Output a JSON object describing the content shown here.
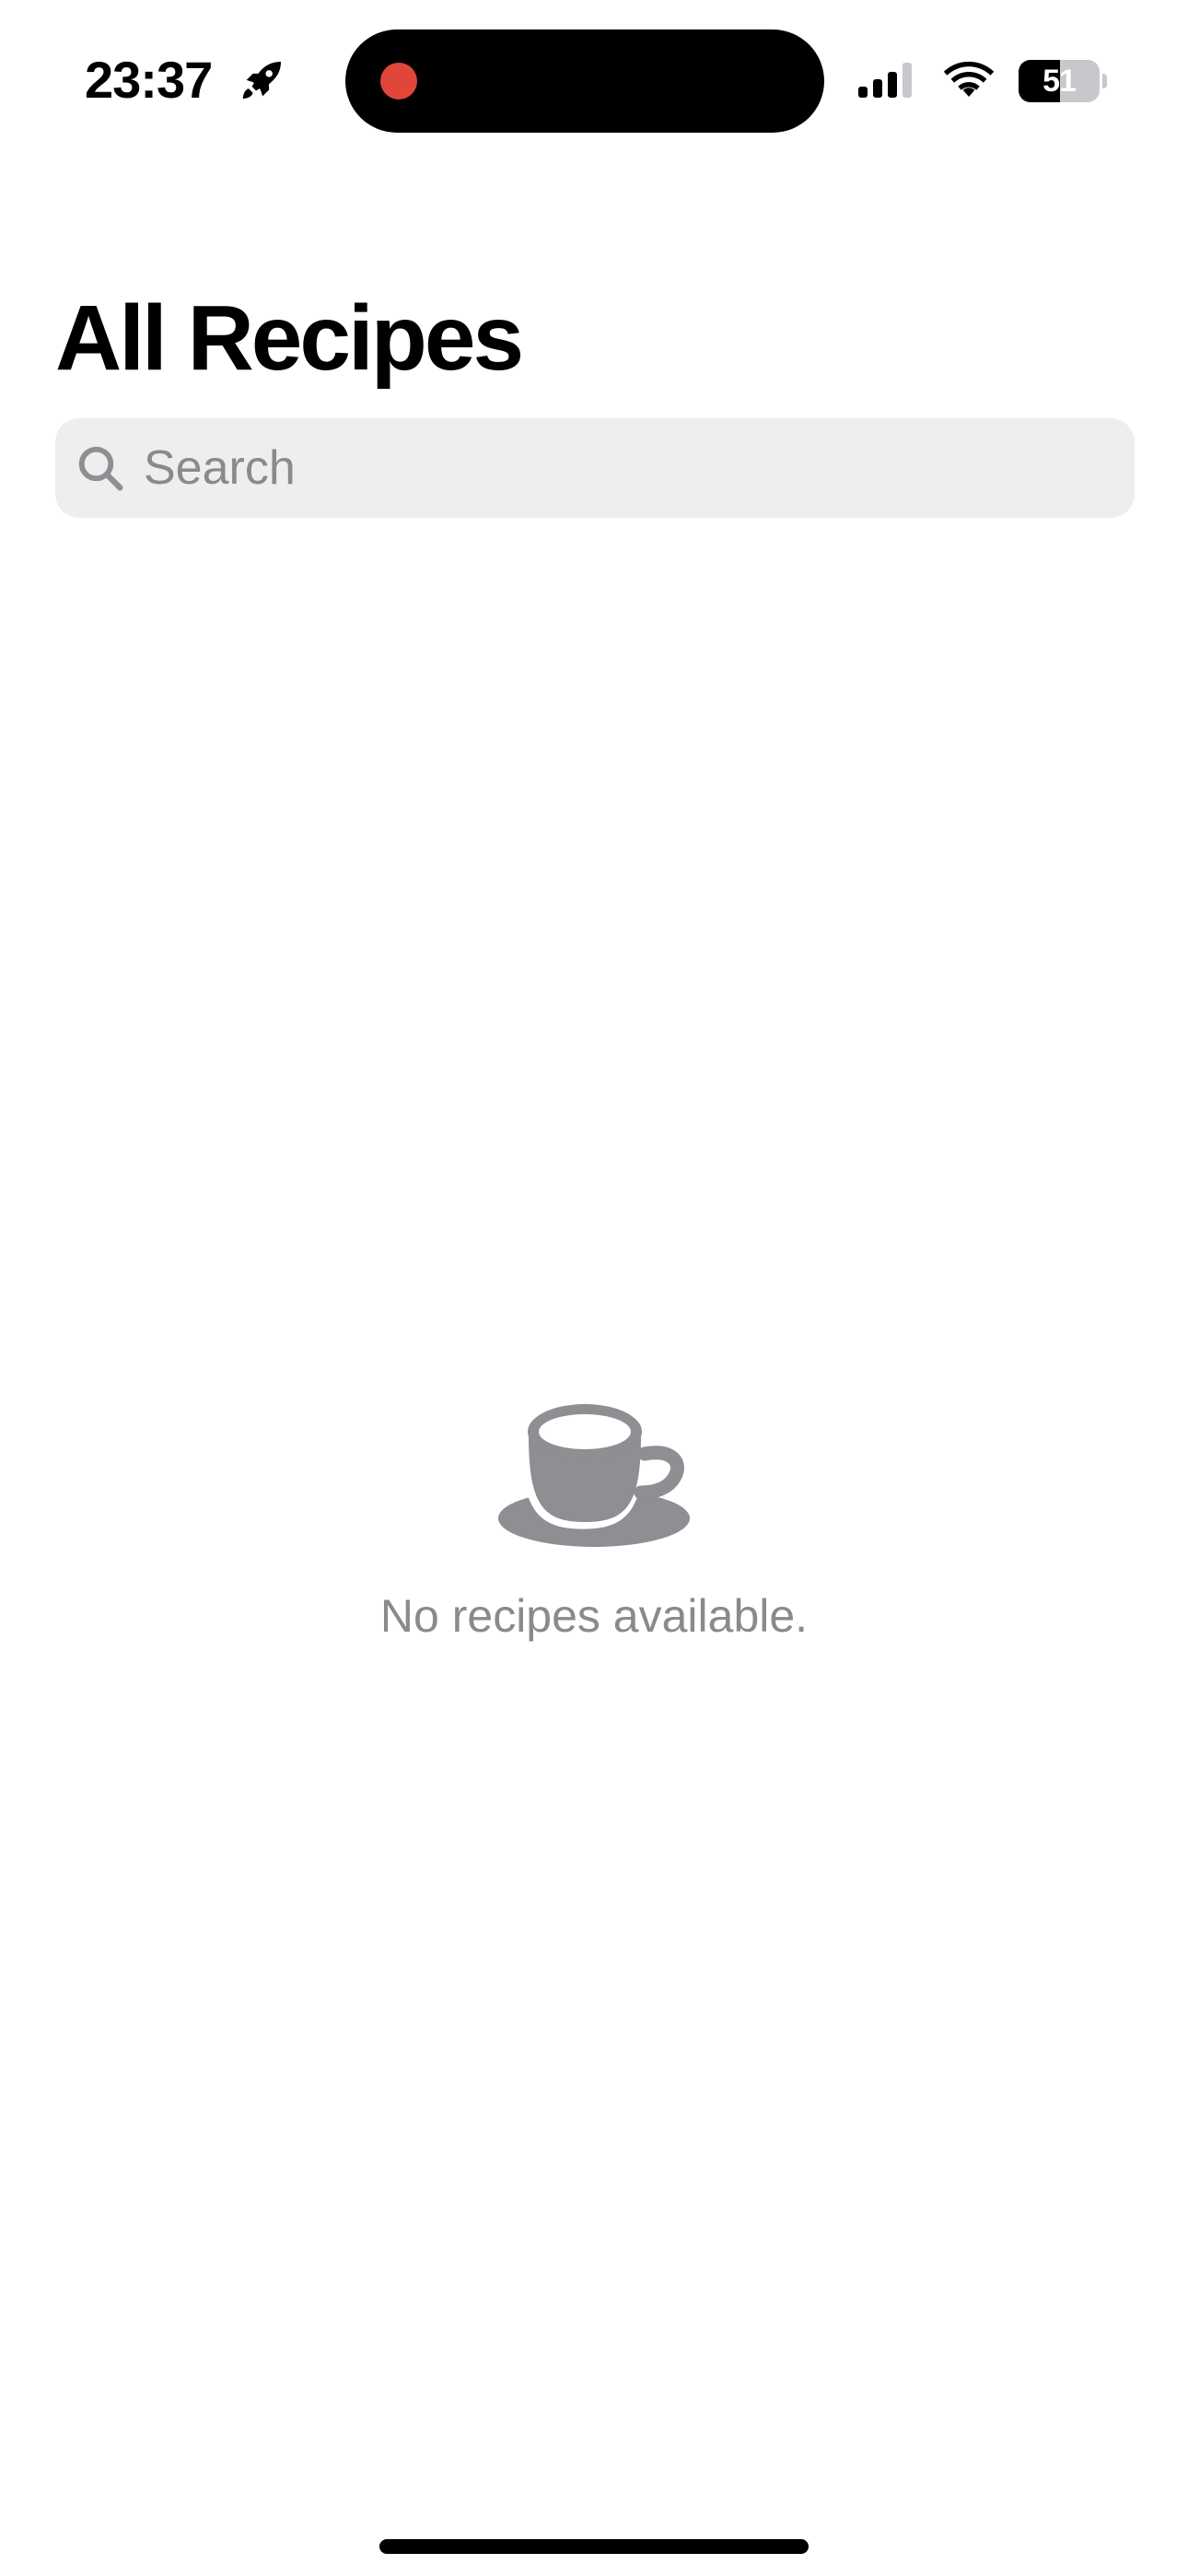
{
  "status_bar": {
    "time": "23:37",
    "time_icon": "rocket-icon",
    "battery_percent": 51,
    "battery_label": "51",
    "recording_color": "#e0463a",
    "icons": [
      "cellular-signal-icon",
      "wifi-icon",
      "battery-icon"
    ]
  },
  "header": {
    "title": "All Recipes"
  },
  "search": {
    "placeholder": "Search",
    "value": "",
    "icon": "magnifying-glass-icon"
  },
  "empty_state": {
    "icon": "coffee-cup-icon",
    "message": "No recipes available."
  },
  "colors": {
    "secondary_text": "#8a8a8e",
    "search_background": "#eeeeef",
    "icon_gray": "#8e8e93"
  }
}
